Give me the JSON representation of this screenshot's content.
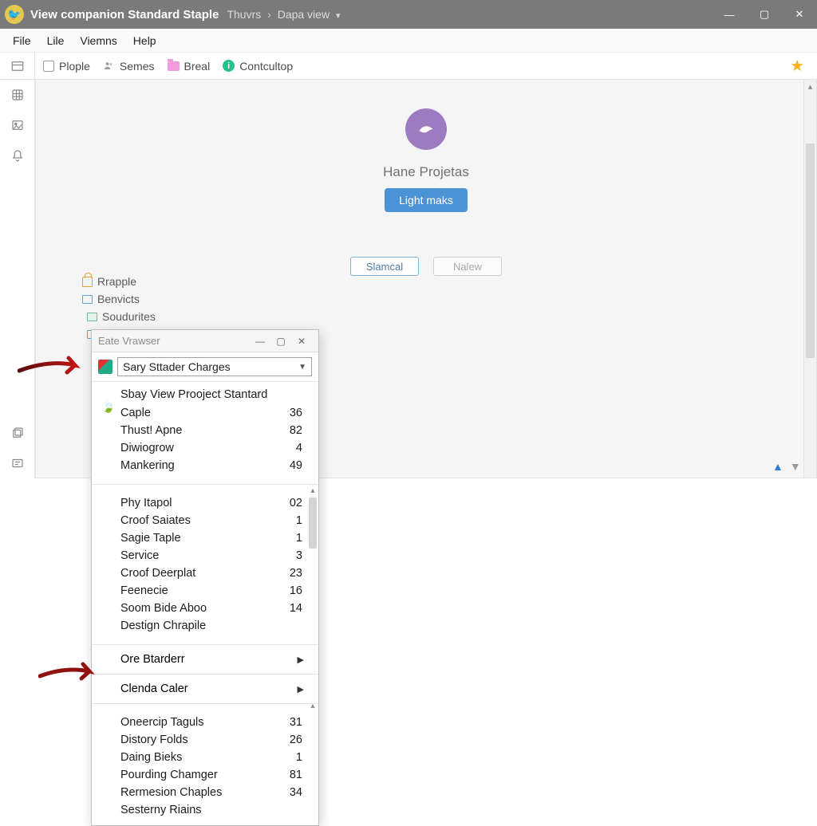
{
  "titlebar": {
    "app_title": "View companion Standard Staple",
    "breadcrumb_a": "Thuvrs",
    "breadcrumb_b": "Dapa view"
  },
  "menubar": [
    "File",
    "Lile",
    "Viemns",
    "Help"
  ],
  "lefticons": [
    "panel-icon",
    "grid-icon",
    "image-icon",
    "bell-icon"
  ],
  "lefticons_bottom": [
    "square-stack-icon",
    "card-icon"
  ],
  "toolbar": {
    "items": [
      {
        "icon": "checkbox-icon",
        "label": "Plople"
      },
      {
        "icon": "people-icon",
        "label": "Semes"
      },
      {
        "icon": "folder-icon",
        "label": "Breal"
      },
      {
        "icon": "dot-icon",
        "label": "Contcultop"
      }
    ]
  },
  "profile": {
    "name": "Hane Projetas",
    "pill": "Light maks",
    "btn_a": "Slamcal",
    "btn_b": "Nalew"
  },
  "tree": [
    {
      "icon": "lock",
      "label": "Rrapple"
    },
    {
      "icon": "box",
      "label": "Benvicts"
    },
    {
      "icon": "gbox",
      "label": "Soudurites"
    },
    {
      "icon": "box2",
      "label": ""
    }
  ],
  "popup": {
    "title": "Eate Vrawser",
    "combo_value": "Sary Sttader Charges",
    "section_a_header": "Sbay View Prooject Stantard",
    "section_a": [
      {
        "label": "Caple",
        "value": "36"
      },
      {
        "label": "Thust! Apne",
        "value": "82"
      },
      {
        "label": "Diwiogrow",
        "value": "4"
      },
      {
        "label": "Mankering",
        "value": "49"
      }
    ],
    "section_b": [
      {
        "label": "Phy Itapol",
        "value": "02"
      },
      {
        "label": "Croof Saiates",
        "value": "1"
      },
      {
        "label": "Sagie Taple",
        "value": "1"
      },
      {
        "label": "Service",
        "value": "3"
      },
      {
        "label": "Croof Deerplat",
        "value": "23"
      },
      {
        "label": "Feenecie",
        "value": "16"
      },
      {
        "label": "Soom Bide Aboo",
        "value": "14"
      },
      {
        "label": "Destign Chrapile",
        "value": ""
      }
    ],
    "submenus": [
      {
        "label": "Ore Btarderr"
      },
      {
        "label": "Clenda Caler"
      }
    ],
    "section_c": [
      {
        "label": "Oneercip Taguls",
        "value": "31"
      },
      {
        "label": "Distory Folds",
        "value": "26"
      },
      {
        "label": "Daing Bieks",
        "value": "1"
      },
      {
        "label": "Pourding Chamger",
        "value": "81"
      },
      {
        "label": "Rermesion Chaples",
        "value": "34"
      },
      {
        "label": "Sesterny Riains",
        "value": ""
      }
    ]
  }
}
